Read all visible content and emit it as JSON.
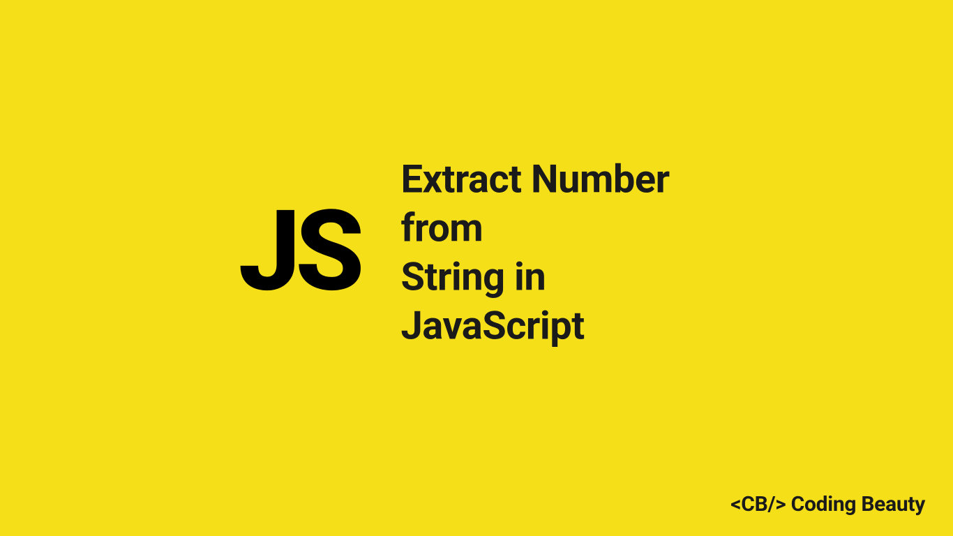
{
  "logo": {
    "text": "JS"
  },
  "title": {
    "line1": "Extract Number from",
    "line2": "String in JavaScript"
  },
  "brand": {
    "text": "<CB/> Coding Beauty"
  }
}
